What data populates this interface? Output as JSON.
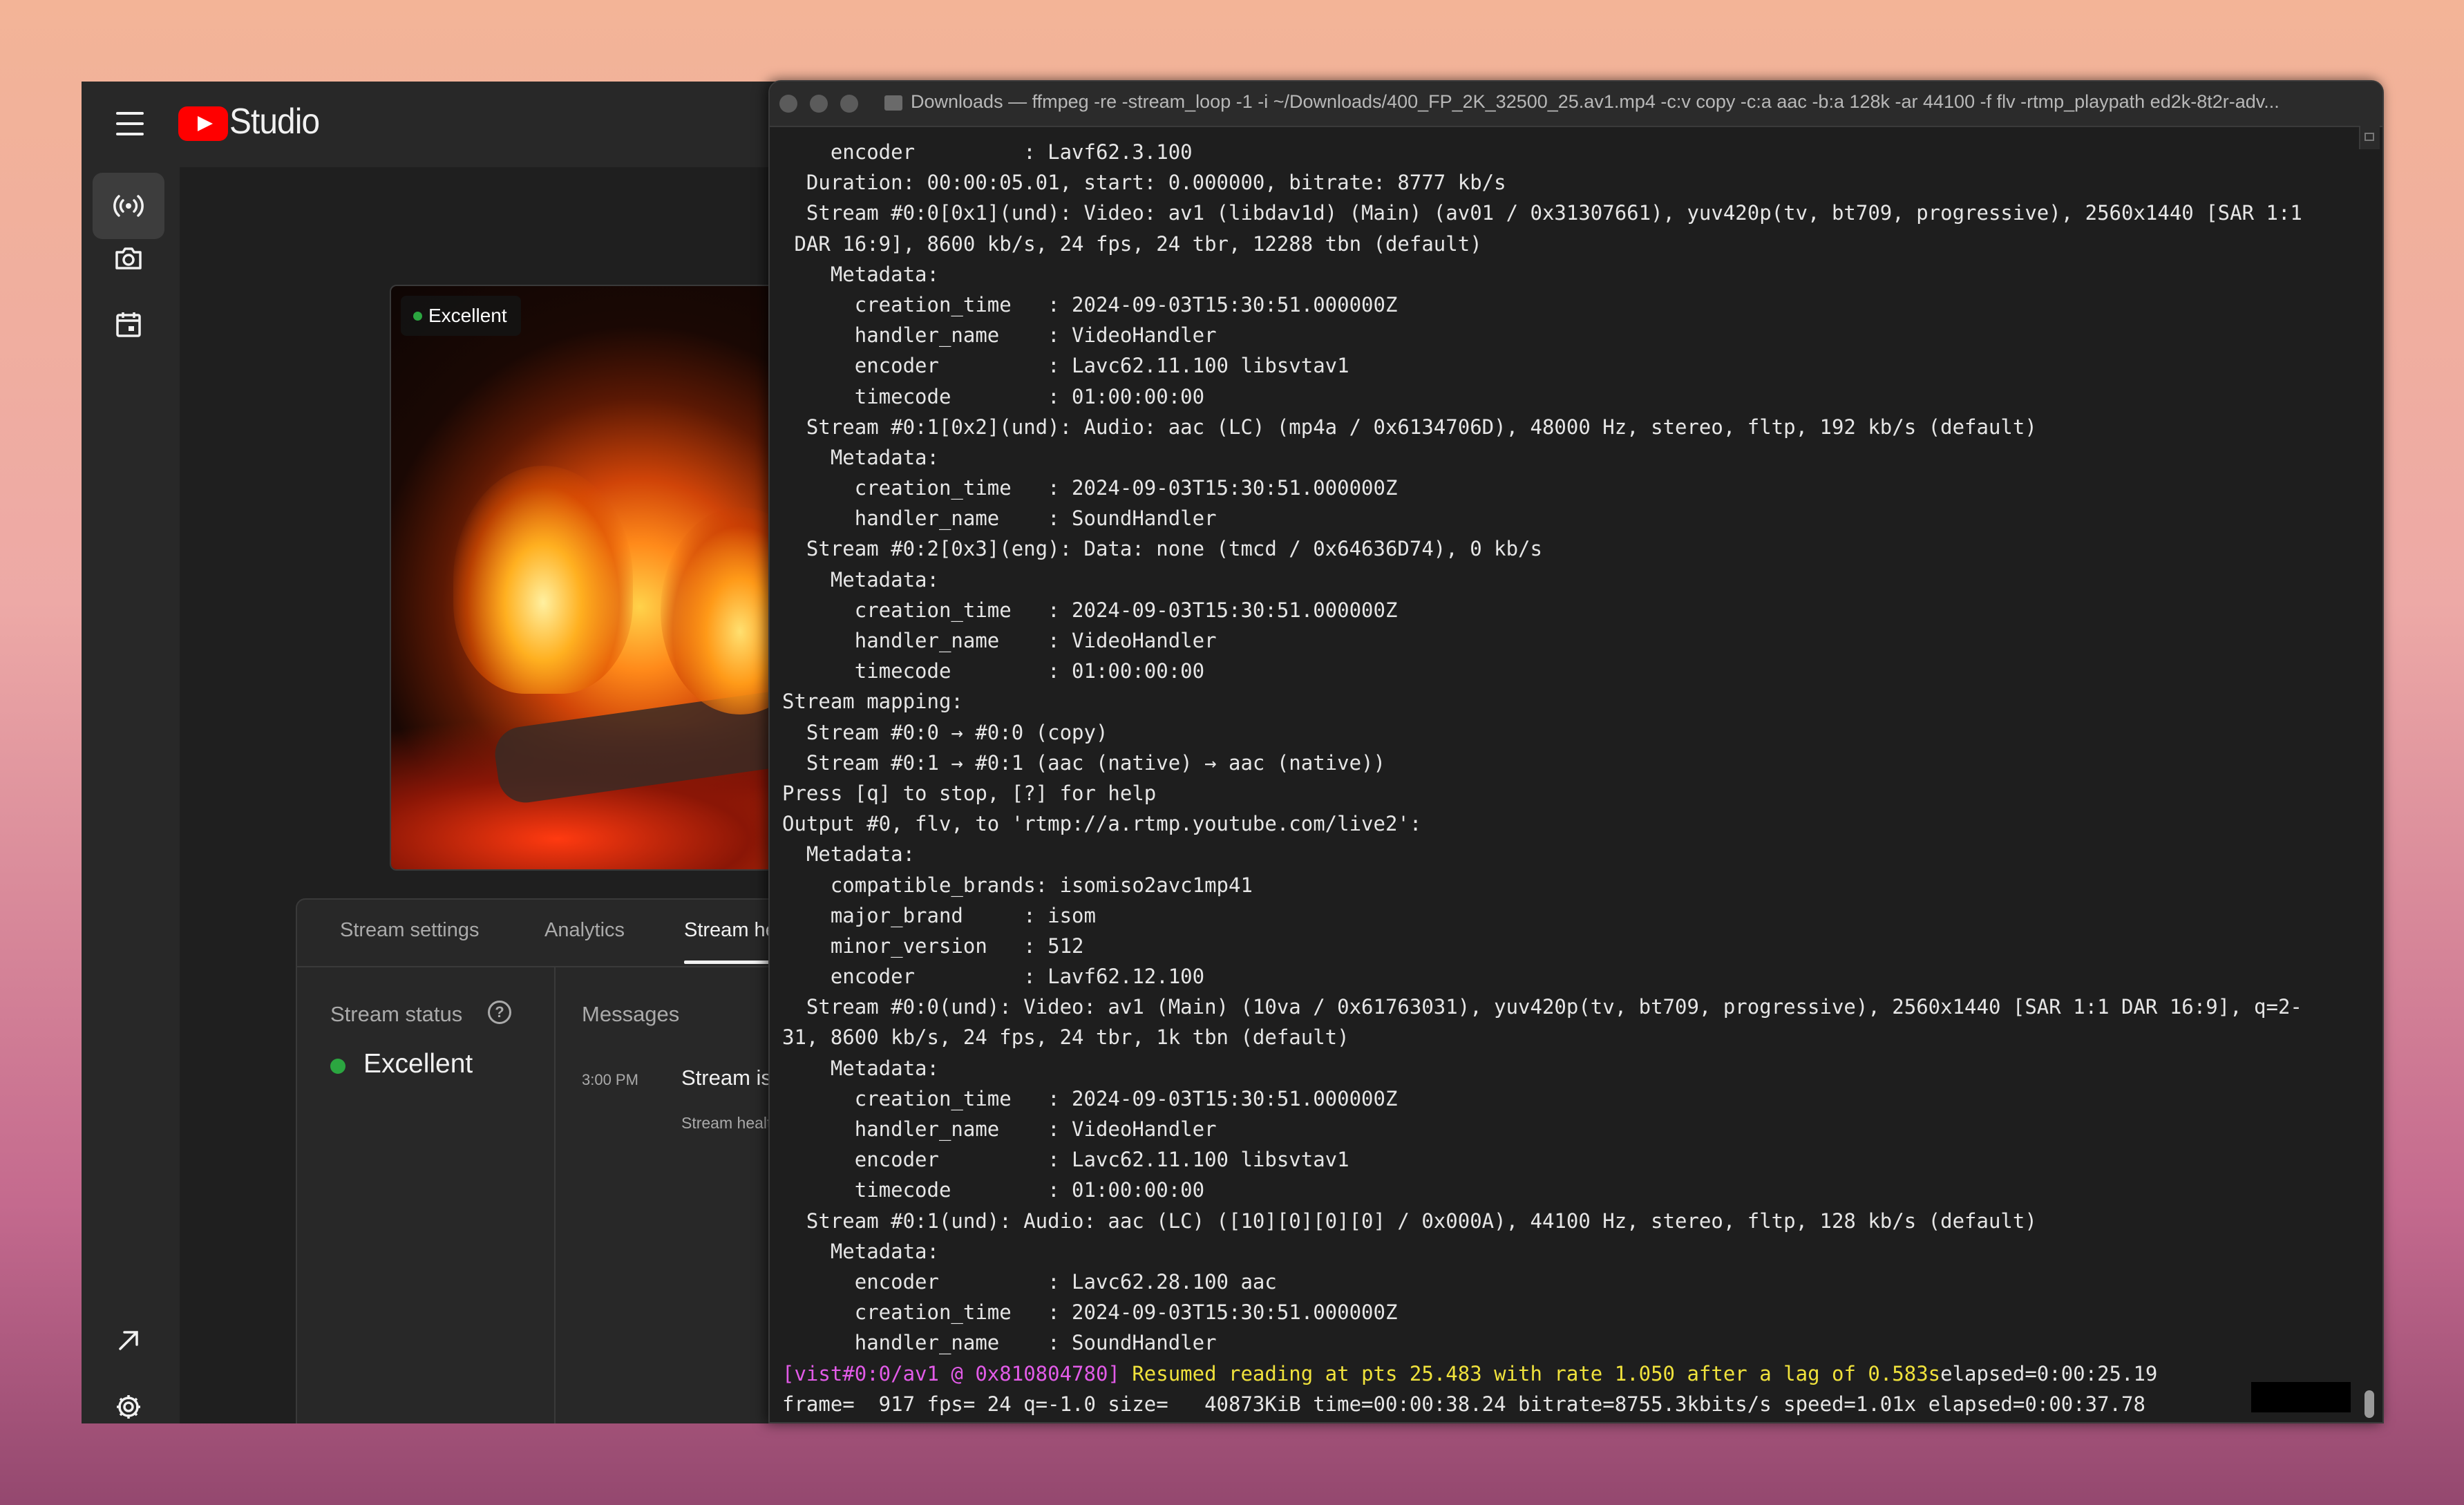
{
  "studio": {
    "title": "Studio",
    "preview_badge": "Excellent",
    "tabs": [
      "Stream settings",
      "Analytics",
      "Stream health"
    ],
    "active_tab": "Stream health",
    "stream_status_label": "Stream status",
    "help_glyph": "?",
    "stream_status_value": "Excellent",
    "messages_label": "Messages",
    "message": {
      "time": "3:00 PM",
      "title": "Stream is healthy",
      "subtitle": "Stream health is excelle"
    },
    "sidebar_icons": [
      "live-broadcast-icon",
      "camera-icon",
      "calendar-icon",
      "external-link-icon",
      "settings-icon",
      "feedback-icon"
    ],
    "colors": {
      "status_good": "#2ba640",
      "logo_red": "#ff0000"
    }
  },
  "terminal": {
    "title": "Downloads — ffmpeg -re -stream_loop -1 -i ~/Downloads/400_FP_2K_32500_25.av1.mp4 -c:v copy -c:a aac -b:a 128k -ar 44100 -f flv -rtmp_playpath ed2k-8t2r-adv...",
    "lines": [
      "    encoder         : Lavf62.3.100",
      "  Duration: 00:00:05.01, start: 0.000000, bitrate: 8777 kb/s",
      "  Stream #0:0[0x1](und): Video: av1 (libdav1d) (Main) (av01 / 0x31307661), yuv420p(tv, bt709, progressive), 2560x1440 [SAR 1:1",
      " DAR 16:9], 8600 kb/s, 24 fps, 24 tbr, 12288 tbn (default)",
      "    Metadata:",
      "      creation_time   : 2024-09-03T15:30:51.000000Z",
      "      handler_name    : VideoHandler",
      "      encoder         : Lavc62.11.100 libsvtav1",
      "      timecode        : 01:00:00:00",
      "  Stream #0:1[0x2](und): Audio: aac (LC) (mp4a / 0x6134706D), 48000 Hz, stereo, fltp, 192 kb/s (default)",
      "    Metadata:",
      "      creation_time   : 2024-09-03T15:30:51.000000Z",
      "      handler_name    : SoundHandler",
      "  Stream #0:2[0x3](eng): Data: none (tmcd / 0x64636D74), 0 kb/s",
      "    Metadata:",
      "      creation_time   : 2024-09-03T15:30:51.000000Z",
      "      handler_name    : VideoHandler",
      "      timecode        : 01:00:00:00",
      "Stream mapping:",
      "  Stream #0:0 → #0:0 (copy)",
      "  Stream #0:1 → #0:1 (aac (native) → aac (native))",
      "Press [q] to stop, [?] for help",
      "Output #0, flv, to 'rtmp://a.rtmp.youtube.com/live2':",
      "  Metadata:",
      "    compatible_brands: isomiso2avc1mp41",
      "    major_brand     : isom",
      "    minor_version   : 512",
      "    encoder         : Lavf62.12.100",
      "  Stream #0:0(und): Video: av1 (Main) (10va / 0x61763031), yuv420p(tv, bt709, progressive), 2560x1440 [SAR 1:1 DAR 16:9], q=2-",
      "31, 8600 kb/s, 24 fps, 24 tbr, 1k tbn (default)",
      "    Metadata:",
      "      creation_time   : 2024-09-03T15:30:51.000000Z",
      "      handler_name    : VideoHandler",
      "      encoder         : Lavc62.11.100 libsvtav1",
      "      timecode        : 01:00:00:00",
      "  Stream #0:1(und): Audio: aac (LC) ([10][0][0][0] / 0x000A), 44100 Hz, stereo, fltp, 128 kb/s (default)",
      "    Metadata:",
      "      encoder         : Lavc62.28.100 aac",
      "      creation_time   : 2024-09-03T15:30:51.000000Z",
      "      handler_name    : SoundHandler"
    ],
    "lag_tag": "[vist#0:0/av1 @ 0x810804780]",
    "lag_message": " Resumed reading at pts 25.483 with rate 1.050 after a lag of 0.583s",
    "lag_suffix": "elapsed=0:00:25.19",
    "progress_line": "frame=  917 fps= 24 q=-1.0 size=   40873KiB time=00:00:38.24 bitrate=8755.3kbits/s speed=1.01x elapsed=0:00:37.78",
    "colors": {
      "lag_tag": "#e25be8",
      "lag_message": "#f0e23c",
      "background": "#1e1e1e"
    }
  }
}
